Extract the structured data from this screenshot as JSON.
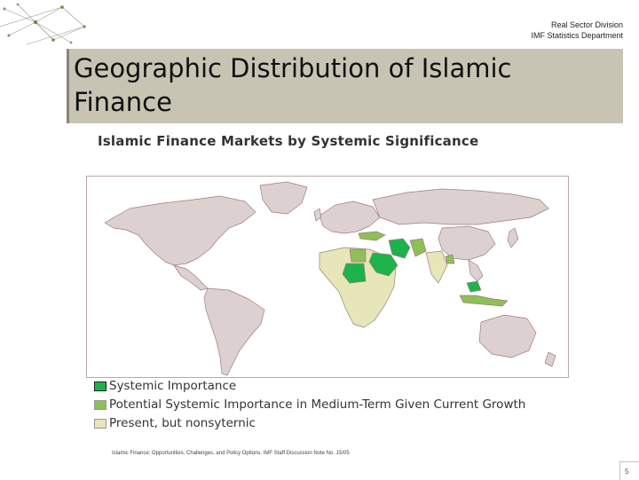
{
  "header": {
    "org_line1": "Real Sector Division",
    "org_line2": "IMF Statistics Department"
  },
  "slide": {
    "title_line1": "Geographic Distribution of Islamic",
    "title_line2": "Finance",
    "page_number": "5"
  },
  "map": {
    "title": "Islamic Finance Markets by Systemic Significance",
    "legend": [
      {
        "label": "Systemic Importance",
        "color": "#1db34b"
      },
      {
        "label": "Potential Systemic Importance in Medium-Term Given Current Growth",
        "color": "#8fbf57"
      },
      {
        "label": "Present, but nonsyternic",
        "color": "#e6e6b8"
      }
    ],
    "colors": {
      "ocean": "#ffffff",
      "other_country": "#ddd0d0",
      "border": "#9a7f7f"
    },
    "source": "Islamic Finance: Opportunities, Challenges, and Policy Options. IMF Staff Discussion Note No. 15/05"
  }
}
